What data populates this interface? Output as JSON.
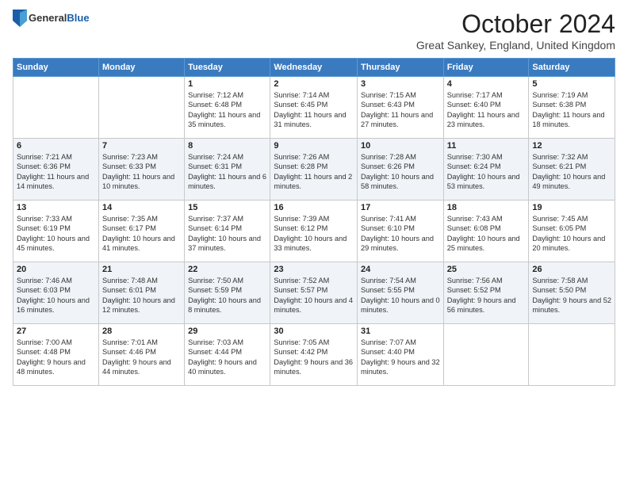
{
  "header": {
    "logo_general": "General",
    "logo_blue": "Blue",
    "month_title": "October 2024",
    "subtitle": "Great Sankey, England, United Kingdom"
  },
  "days_of_week": [
    "Sunday",
    "Monday",
    "Tuesday",
    "Wednesday",
    "Thursday",
    "Friday",
    "Saturday"
  ],
  "weeks": [
    [
      {
        "day": "",
        "info": ""
      },
      {
        "day": "",
        "info": ""
      },
      {
        "day": "1",
        "info": "Sunrise: 7:12 AM\nSunset: 6:48 PM\nDaylight: 11 hours and 35 minutes."
      },
      {
        "day": "2",
        "info": "Sunrise: 7:14 AM\nSunset: 6:45 PM\nDaylight: 11 hours and 31 minutes."
      },
      {
        "day": "3",
        "info": "Sunrise: 7:15 AM\nSunset: 6:43 PM\nDaylight: 11 hours and 27 minutes."
      },
      {
        "day": "4",
        "info": "Sunrise: 7:17 AM\nSunset: 6:40 PM\nDaylight: 11 hours and 23 minutes."
      },
      {
        "day": "5",
        "info": "Sunrise: 7:19 AM\nSunset: 6:38 PM\nDaylight: 11 hours and 18 minutes."
      }
    ],
    [
      {
        "day": "6",
        "info": "Sunrise: 7:21 AM\nSunset: 6:36 PM\nDaylight: 11 hours and 14 minutes."
      },
      {
        "day": "7",
        "info": "Sunrise: 7:23 AM\nSunset: 6:33 PM\nDaylight: 11 hours and 10 minutes."
      },
      {
        "day": "8",
        "info": "Sunrise: 7:24 AM\nSunset: 6:31 PM\nDaylight: 11 hours and 6 minutes."
      },
      {
        "day": "9",
        "info": "Sunrise: 7:26 AM\nSunset: 6:28 PM\nDaylight: 11 hours and 2 minutes."
      },
      {
        "day": "10",
        "info": "Sunrise: 7:28 AM\nSunset: 6:26 PM\nDaylight: 10 hours and 58 minutes."
      },
      {
        "day": "11",
        "info": "Sunrise: 7:30 AM\nSunset: 6:24 PM\nDaylight: 10 hours and 53 minutes."
      },
      {
        "day": "12",
        "info": "Sunrise: 7:32 AM\nSunset: 6:21 PM\nDaylight: 10 hours and 49 minutes."
      }
    ],
    [
      {
        "day": "13",
        "info": "Sunrise: 7:33 AM\nSunset: 6:19 PM\nDaylight: 10 hours and 45 minutes."
      },
      {
        "day": "14",
        "info": "Sunrise: 7:35 AM\nSunset: 6:17 PM\nDaylight: 10 hours and 41 minutes."
      },
      {
        "day": "15",
        "info": "Sunrise: 7:37 AM\nSunset: 6:14 PM\nDaylight: 10 hours and 37 minutes."
      },
      {
        "day": "16",
        "info": "Sunrise: 7:39 AM\nSunset: 6:12 PM\nDaylight: 10 hours and 33 minutes."
      },
      {
        "day": "17",
        "info": "Sunrise: 7:41 AM\nSunset: 6:10 PM\nDaylight: 10 hours and 29 minutes."
      },
      {
        "day": "18",
        "info": "Sunrise: 7:43 AM\nSunset: 6:08 PM\nDaylight: 10 hours and 25 minutes."
      },
      {
        "day": "19",
        "info": "Sunrise: 7:45 AM\nSunset: 6:05 PM\nDaylight: 10 hours and 20 minutes."
      }
    ],
    [
      {
        "day": "20",
        "info": "Sunrise: 7:46 AM\nSunset: 6:03 PM\nDaylight: 10 hours and 16 minutes."
      },
      {
        "day": "21",
        "info": "Sunrise: 7:48 AM\nSunset: 6:01 PM\nDaylight: 10 hours and 12 minutes."
      },
      {
        "day": "22",
        "info": "Sunrise: 7:50 AM\nSunset: 5:59 PM\nDaylight: 10 hours and 8 minutes."
      },
      {
        "day": "23",
        "info": "Sunrise: 7:52 AM\nSunset: 5:57 PM\nDaylight: 10 hours and 4 minutes."
      },
      {
        "day": "24",
        "info": "Sunrise: 7:54 AM\nSunset: 5:55 PM\nDaylight: 10 hours and 0 minutes."
      },
      {
        "day": "25",
        "info": "Sunrise: 7:56 AM\nSunset: 5:52 PM\nDaylight: 9 hours and 56 minutes."
      },
      {
        "day": "26",
        "info": "Sunrise: 7:58 AM\nSunset: 5:50 PM\nDaylight: 9 hours and 52 minutes."
      }
    ],
    [
      {
        "day": "27",
        "info": "Sunrise: 7:00 AM\nSunset: 4:48 PM\nDaylight: 9 hours and 48 minutes."
      },
      {
        "day": "28",
        "info": "Sunrise: 7:01 AM\nSunset: 4:46 PM\nDaylight: 9 hours and 44 minutes."
      },
      {
        "day": "29",
        "info": "Sunrise: 7:03 AM\nSunset: 4:44 PM\nDaylight: 9 hours and 40 minutes."
      },
      {
        "day": "30",
        "info": "Sunrise: 7:05 AM\nSunset: 4:42 PM\nDaylight: 9 hours and 36 minutes."
      },
      {
        "day": "31",
        "info": "Sunrise: 7:07 AM\nSunset: 4:40 PM\nDaylight: 9 hours and 32 minutes."
      },
      {
        "day": "",
        "info": ""
      },
      {
        "day": "",
        "info": ""
      }
    ]
  ]
}
